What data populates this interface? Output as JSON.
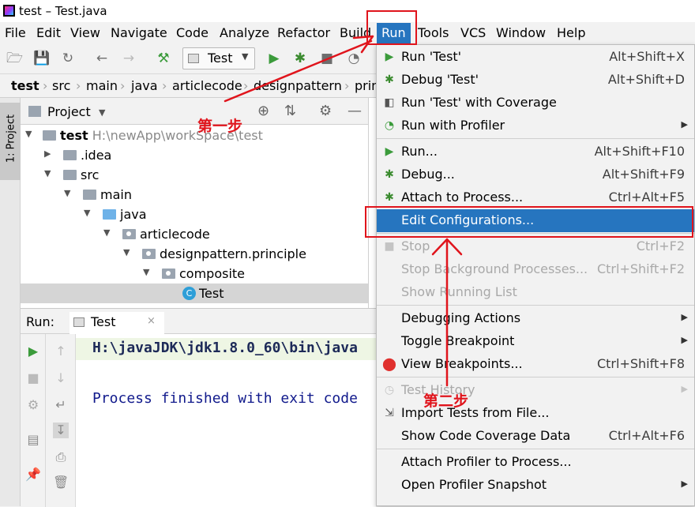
{
  "window": {
    "title": "test – Test.java"
  },
  "menubar": {
    "items": [
      "File",
      "Edit",
      "View",
      "Navigate",
      "Code",
      "Analyze",
      "Refactor",
      "Build",
      "Run",
      "Tools",
      "VCS",
      "Window",
      "Help"
    ],
    "active": "Run"
  },
  "toolbar": {
    "run_config": "Test"
  },
  "breadcrumb": {
    "items": [
      "test",
      "src",
      "main",
      "java",
      "articlecode",
      "designpattern",
      "prin"
    ]
  },
  "left_strip": {
    "project_tab": "1: Project"
  },
  "project_panel": {
    "title": "Project",
    "tree": [
      {
        "label": "test",
        "path": "H:\\newApp\\workSpace\\test"
      },
      {
        "label": ".idea"
      },
      {
        "label": "src"
      },
      {
        "label": "main"
      },
      {
        "label": "java"
      },
      {
        "label": "articlecode"
      },
      {
        "label": "designpattern.principle"
      },
      {
        "label": "composite"
      },
      {
        "label": "Test"
      }
    ]
  },
  "run_panel": {
    "label": "Run:",
    "tab": "Test",
    "tab_close": "×",
    "console": [
      "H:\\javaJDK\\jdk1.8.0_60\\bin\\java",
      "Process finished with exit code"
    ]
  },
  "run_menu": {
    "items": [
      {
        "label": "Run 'Test'",
        "shortcut": "Alt+Shift+X",
        "icon": "play-icon"
      },
      {
        "label": "Debug 'Test'",
        "shortcut": "Alt+Shift+D",
        "icon": "bug-icon"
      },
      {
        "label": "Run 'Test' with Coverage",
        "shortcut": "",
        "icon": "coverage-icon"
      },
      {
        "label": "Run with Profiler",
        "shortcut": "",
        "icon": "profiler-icon",
        "submenu": true
      },
      {
        "label": "Run...",
        "shortcut": "Alt+Shift+F10",
        "icon": "play-icon"
      },
      {
        "label": "Debug...",
        "shortcut": "Alt+Shift+F9",
        "icon": "bug-icon"
      },
      {
        "label": "Attach to Process...",
        "shortcut": "Ctrl+Alt+F5",
        "icon": "attach-icon"
      },
      {
        "label": "Edit Configurations...",
        "shortcut": "",
        "highlight": true
      },
      {
        "label": "Stop",
        "shortcut": "Ctrl+F2",
        "icon": "stop-icon",
        "disabled": true
      },
      {
        "label": "Stop Background Processes...",
        "shortcut": "Ctrl+Shift+F2",
        "disabled": true
      },
      {
        "label": "Show Running List",
        "shortcut": "",
        "disabled": true
      },
      {
        "label": "Debugging Actions",
        "shortcut": "",
        "submenu": true
      },
      {
        "label": "Toggle Breakpoint",
        "shortcut": "",
        "submenu": true
      },
      {
        "label": "View Breakpoints...",
        "shortcut": "Ctrl+Shift+F8",
        "icon": "breakpoints-icon"
      },
      {
        "label": "Test History",
        "shortcut": "",
        "icon": "history-icon",
        "disabled": true,
        "submenu": true
      },
      {
        "label": "Import Tests from File...",
        "shortcut": "",
        "icon": "import-icon"
      },
      {
        "label": "Show Code Coverage Data",
        "shortcut": "Ctrl+Alt+F6"
      },
      {
        "label": "Attach Profiler to Process...",
        "shortcut": ""
      },
      {
        "label": "Open Profiler Snapshot",
        "shortcut": "",
        "submenu": true
      }
    ]
  },
  "annotations": {
    "step1": "第一步",
    "step2": "第二步",
    "color": "#e0141c"
  },
  "colors": {
    "highlight": "#2675bf",
    "run_green": "#3b9b3b",
    "debug_green": "#3b8b2f"
  }
}
